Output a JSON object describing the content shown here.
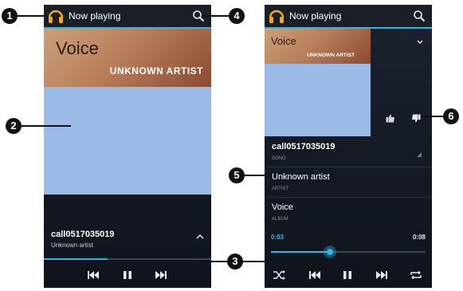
{
  "header": {
    "title": "Now playing"
  },
  "album_art": {
    "title": "Voice",
    "artist": "UNKNOWN ARTIST"
  },
  "left_player": {
    "song_title": "call0517035019",
    "song_artist": "Unknown artist",
    "progress": 0.38
  },
  "details": {
    "song": {
      "value": "call0517035019",
      "label": "SONG"
    },
    "artist": {
      "value": "Unknown artist",
      "label": "ARTIST"
    },
    "album": {
      "value": "Voice",
      "label": "ALBUM"
    }
  },
  "right_player": {
    "elapsed": "0:03",
    "duration": "0:08",
    "progress": 0.38
  },
  "callouts": [
    "1",
    "2",
    "3",
    "4",
    "5",
    "6"
  ],
  "colors": {
    "accent": "#33b5e5",
    "art_blue": "#9bbbe6"
  },
  "icons": [
    "headphones-icon",
    "search-icon",
    "chevron-up-icon",
    "chevron-down-icon",
    "thumbs-up-icon",
    "thumbs-down-icon",
    "previous-icon",
    "pause-icon",
    "next-icon",
    "shuffle-icon",
    "repeat-icon"
  ]
}
